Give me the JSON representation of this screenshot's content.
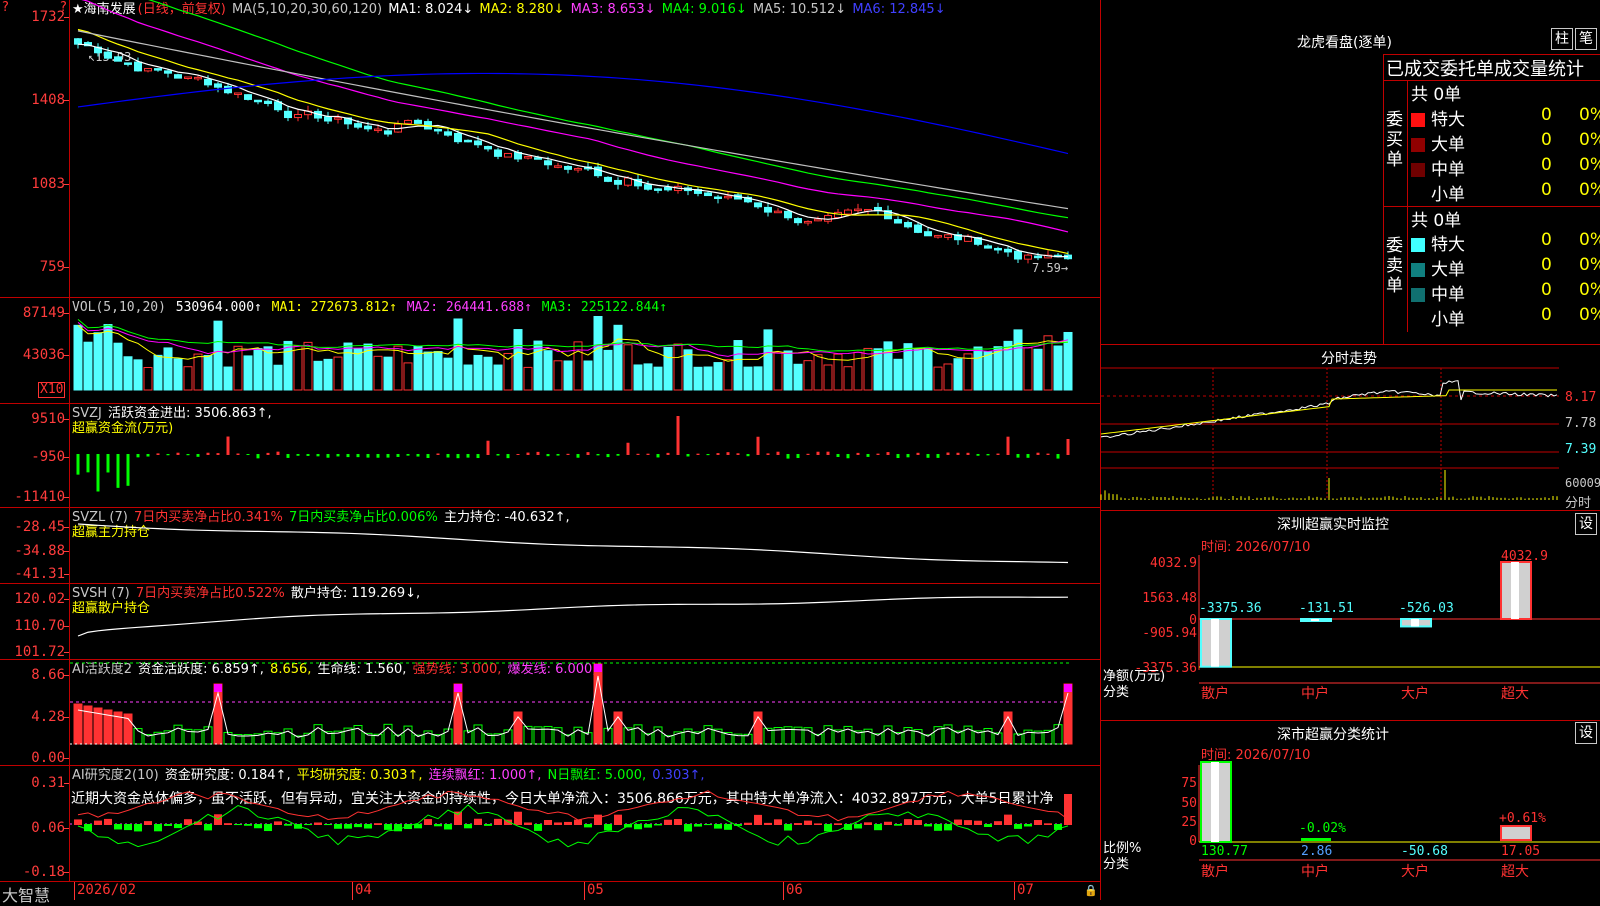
{
  "colors": {
    "up": "#ff3232",
    "down": "#54ffff",
    "grid": "#c00000",
    "ma1": "#ffffff",
    "ma2": "#ffff00",
    "ma3": "#ff00ff",
    "ma4": "#00ff00",
    "ma5": "#c0c0c0",
    "ma6": "#0000ff"
  },
  "top_left": {
    "question_icon": "?",
    "right_question_icon": "?"
  },
  "price_panel": {
    "title": "★海南发展",
    "mode": "(日线，前复权)",
    "ma_list": "MA(5,10,20,30,60,120)",
    "ma1": "MA1: 8.024↓",
    "ma2": "MA2: 8.280↓",
    "ma3": "MA3: 8.653↓",
    "ma4": "MA4: 9.016↓",
    "ma5": "MA5: 10.512↓",
    "ma6": "MA6: 12.845↓",
    "y_labels": [
      "1732",
      "1408",
      "1083",
      "759"
    ],
    "high_label": "15.93",
    "low_label": "7.59"
  },
  "vol_panel": {
    "title": "VOL(5,10,20)",
    "value": "530964.000↑",
    "ma1": "MA1: 272673.812↑",
    "ma2": "MA2: 264441.688↑",
    "ma3": "MA3: 225122.844↑",
    "y_labels": [
      "87149",
      "43036"
    ],
    "unit": "X10"
  },
  "svzj_panel": {
    "title": "SVZJ",
    "label": "活跃资金进出: 3506.863↑,",
    "sub": "超赢资金流(万元)",
    "y_labels": [
      "9510",
      "-950",
      "-11410"
    ]
  },
  "svzl_panel": {
    "title": "SVZL (7)",
    "p1": "7日内买卖净占比0.341%",
    "p2": "7日内买卖净占比0.006%",
    "p3": "主力持仓: -40.632↑,",
    "sub": "超赢主力持仓",
    "y_labels": [
      "-28.45",
      "-34.88",
      "-41.31"
    ]
  },
  "svsh_panel": {
    "title": "SVSH (7)",
    "p1": "7日内买卖净占比0.522%",
    "p2": "散户持仓: 119.269↓,",
    "sub": "超赢散户持仓",
    "y_labels": [
      "120.02",
      "110.70",
      "101.72"
    ]
  },
  "ai1_panel": {
    "title": "AI活跃度2",
    "p1": "资金活跃度: 6.859↑,",
    "p2": "8.656,",
    "p3": "生命线: 1.560,",
    "p4": "强势线: 3.000,",
    "p5": "爆发线: 6.000,",
    "y_labels": [
      "8.66",
      "4.28",
      "0.00"
    ]
  },
  "ai2_panel": {
    "title": "AI研究度2(10)",
    "p1": "资金研究度: 0.184↑,",
    "p2": "平均研究度: 0.303↑,",
    "p3": "连续飘红: 1.000↑,",
    "p4": "N日飘红: 5.000,",
    "p5": "0.303↑,",
    "comment": "近期大资金总体偏多，虽不活跃，但有异动，宜关注大资金的持续性，今日大单净流入：3506.866万元，其中特大单净流入：4032.897万元，大单5日累计净",
    "y_labels": [
      "0.31",
      "0.06",
      "-0.18"
    ]
  },
  "x_axis": {
    "brand": "大智慧",
    "labels": [
      "2026/02",
      "04",
      "05",
      "06",
      "07"
    ]
  },
  "right": {
    "lhb_title": "龙虎看盘(逐单)",
    "btn_zhu": "柱",
    "btn_bi": "笔",
    "tab_title": "已成交委托单成交量统计",
    "buy_label": "委买单",
    "sell_label": "委卖单",
    "buy_total": "共 0单",
    "sell_total": "共 0单",
    "buy_rows": [
      {
        "name": "特大",
        "count": "0",
        "pct": "0%"
      },
      {
        "name": "大单",
        "count": "0",
        "pct": "0%"
      },
      {
        "name": "中单",
        "count": "0",
        "pct": "0%"
      },
      {
        "name": "小单",
        "count": "0",
        "pct": "0%"
      }
    ],
    "sell_rows": [
      {
        "name": "特大",
        "count": "0",
        "pct": "0%"
      },
      {
        "name": "大单",
        "count": "0",
        "pct": "0%"
      },
      {
        "name": "中单",
        "count": "0",
        "pct": "0%"
      },
      {
        "name": "小单",
        "count": "0",
        "pct": "0%"
      }
    ],
    "intraday_title": "分时走势",
    "intraday_labels": [
      "8.17",
      "7.78",
      "7.39",
      "60009",
      "分时"
    ],
    "monitor_title": "深圳超赢实时监控",
    "monitor_time": "时间: 2026/07/10",
    "set_label": "设",
    "monitor_y": [
      "4032.9",
      "1563.48",
      "0",
      "-905.94",
      "-3375.36"
    ],
    "monitor_vals": [
      "-3375.36",
      "-131.51",
      "-526.03",
      "4032.9"
    ],
    "monitor_unit": "净额(万元)",
    "monitor_unit2": "分类",
    "cats": [
      "散户",
      "中户",
      "大户",
      "超大"
    ],
    "class_title": "深市超赢分类统计",
    "class_time": "时间: 2026/07/10",
    "class_y": [
      "75",
      "50",
      "25",
      "0"
    ],
    "class_top": [
      "-0.02%",
      "+0.61%"
    ],
    "class_vals": [
      "130.77",
      "2.86",
      "-50.68",
      "17.05"
    ],
    "class_unit": "比例%",
    "class_unit2": "分类"
  }
}
